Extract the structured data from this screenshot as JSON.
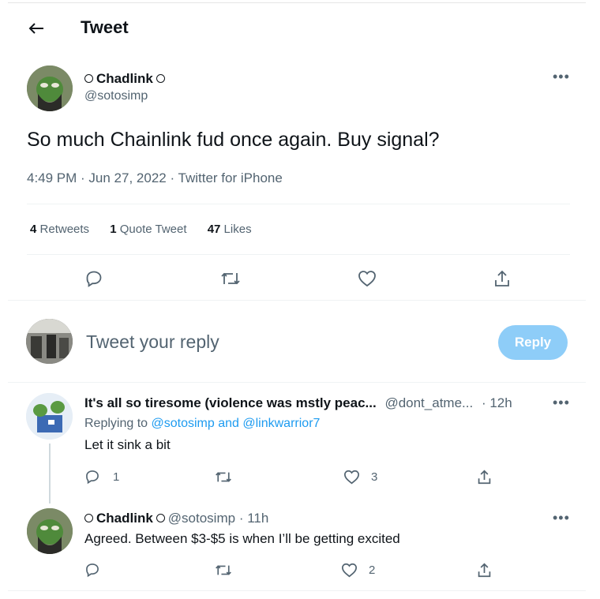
{
  "header": {
    "title": "Tweet"
  },
  "tweet": {
    "display_name": "Chadlink",
    "handle": "@sotosimp",
    "text": "So much Chainlink fud once again. Buy signal?",
    "meta": "4:49 PM · Jun 27, 2022 · Twitter for iPhone",
    "stats": {
      "retweets_count": "4",
      "retweets_label": "Retweets",
      "quotes_count": "1",
      "quotes_label": "Quote Tweet",
      "likes_count": "47",
      "likes_label": "Likes"
    },
    "actions": [
      "reply-icon",
      "retweet-icon",
      "like-icon",
      "share-icon"
    ]
  },
  "composer": {
    "placeholder": "Tweet your reply",
    "reply_label": "Reply",
    "reply_button_color": "#8ecdf8"
  },
  "replies": [
    {
      "display_name": "It's all so tiresome (violence was mstly peac...",
      "handle": "@dont_atme...",
      "time": "· 12h",
      "replying_prefix": "Replying to",
      "replying_to_1": "@sotosimp",
      "replying_and": "and",
      "replying_to_2": "@linkwarrior7",
      "text": "Let it sink a bit",
      "reply_count": "1",
      "like_count": "3"
    },
    {
      "display_name": "Chadlink",
      "handle": "@sotosimp",
      "time": "· 11h",
      "text": "Agreed. Between $3-$5 is when I’ll be getting excited",
      "like_count": "2"
    }
  ],
  "colors": {
    "link": "#1d9bf0",
    "secondary_text": "#536471",
    "divider": "#eff3f4"
  }
}
